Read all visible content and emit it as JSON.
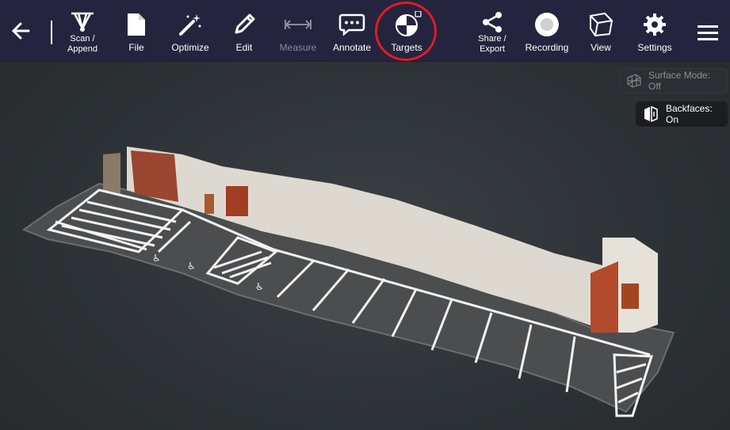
{
  "toolbar": {
    "items": [
      {
        "label": "Scan /",
        "label2": "Append"
      },
      {
        "label": "File"
      },
      {
        "label": "Optimize"
      },
      {
        "label": "Edit"
      },
      {
        "label": "Measure"
      },
      {
        "label": "Annotate"
      },
      {
        "label": "Targets"
      },
      {
        "label": "Share /",
        "label2": "Export"
      },
      {
        "label": "Recording"
      },
      {
        "label": "View"
      },
      {
        "label": "Settings"
      }
    ]
  },
  "overlay": {
    "surface_mode": "Surface Mode: Off",
    "backfaces": "Backfaces: On"
  },
  "colors": {
    "toolbar_bg": "#25243f",
    "highlight": "#e01c24",
    "viewport_bg": "#2d3236"
  },
  "icons": [
    "back-arrow-icon",
    "scan-icon",
    "file-icon",
    "magic-wand-icon",
    "pencil-icon",
    "measure-icon",
    "speech-bubble-icon",
    "target-icon",
    "share-icon",
    "record-icon",
    "cube-view-icon",
    "gear-icon",
    "hamburger-menu-icon",
    "surface-mesh-icon",
    "backfaces-icon"
  ]
}
